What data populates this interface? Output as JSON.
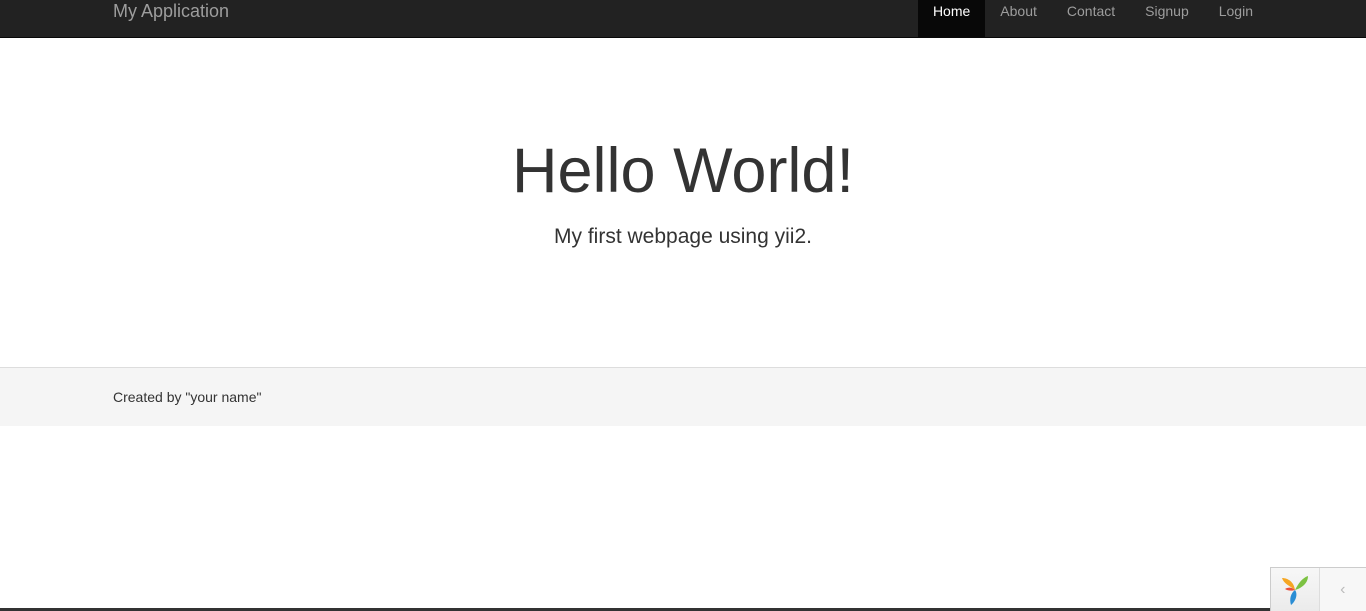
{
  "navbar": {
    "brand": "My Application",
    "items": [
      {
        "label": "Home",
        "active": true
      },
      {
        "label": "About",
        "active": false
      },
      {
        "label": "Contact",
        "active": false
      },
      {
        "label": "Signup",
        "active": false
      },
      {
        "label": "Login",
        "active": false
      }
    ]
  },
  "jumbotron": {
    "title": "Hello World!",
    "lead": "My first webpage using yii2."
  },
  "footer": {
    "text": "Created by \"your name\""
  },
  "debug_toolbar": {
    "logo_icon": "yii-logo-icon",
    "toggle_icon": "chevron-left-icon",
    "toggle_glyph": "‹"
  },
  "colors": {
    "navbar_bg": "#222222",
    "nav_active_bg": "#080808",
    "nav_text": "#9d9d9d",
    "footer_bg": "#f5f5f5"
  }
}
